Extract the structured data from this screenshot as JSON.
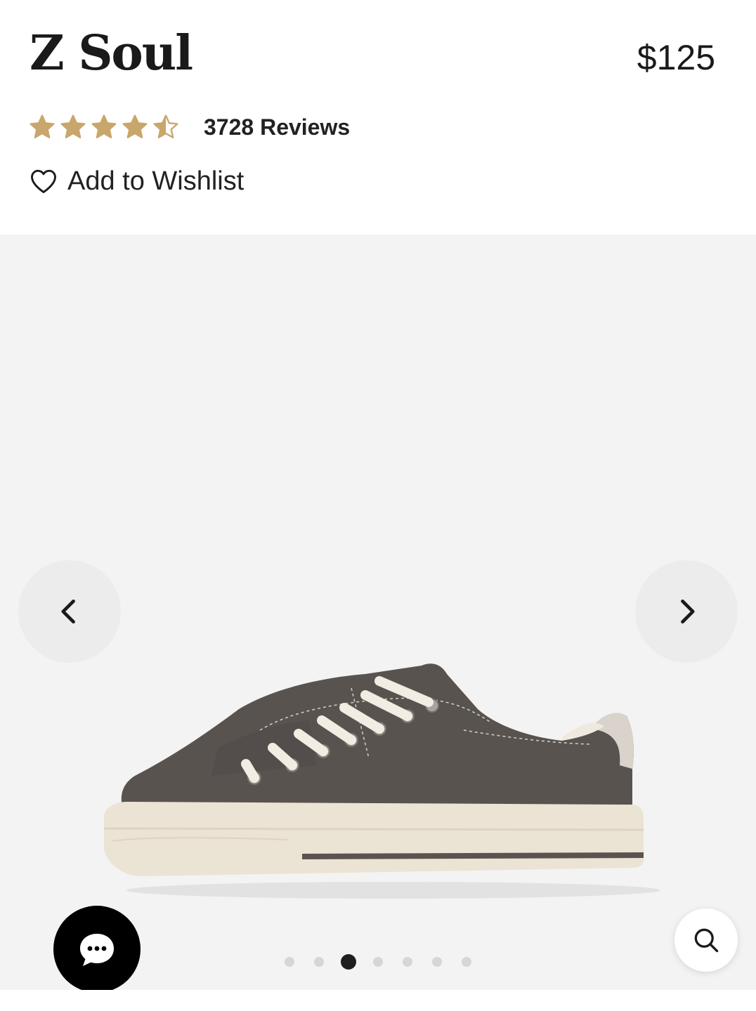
{
  "product": {
    "title": "Z Soul",
    "price": "$125"
  },
  "rating": {
    "value": 4.5,
    "max": 5,
    "reviews_label": "3728 Reviews",
    "star_color": "#c9a66b"
  },
  "wishlist": {
    "label": "Add to Wishlist",
    "icon": "heart-outline-icon"
  },
  "gallery": {
    "image": "side view of a charcoal grey canvas low-top lace-up sneaker with cream sole",
    "prev_icon": "chevron-left-icon",
    "next_icon": "chevron-right-icon",
    "slide_count": 7,
    "active_slide": 3
  },
  "chat": {
    "icon": "chat-bubble-icon",
    "color": "#000000"
  },
  "zoom": {
    "icon": "search-icon"
  }
}
